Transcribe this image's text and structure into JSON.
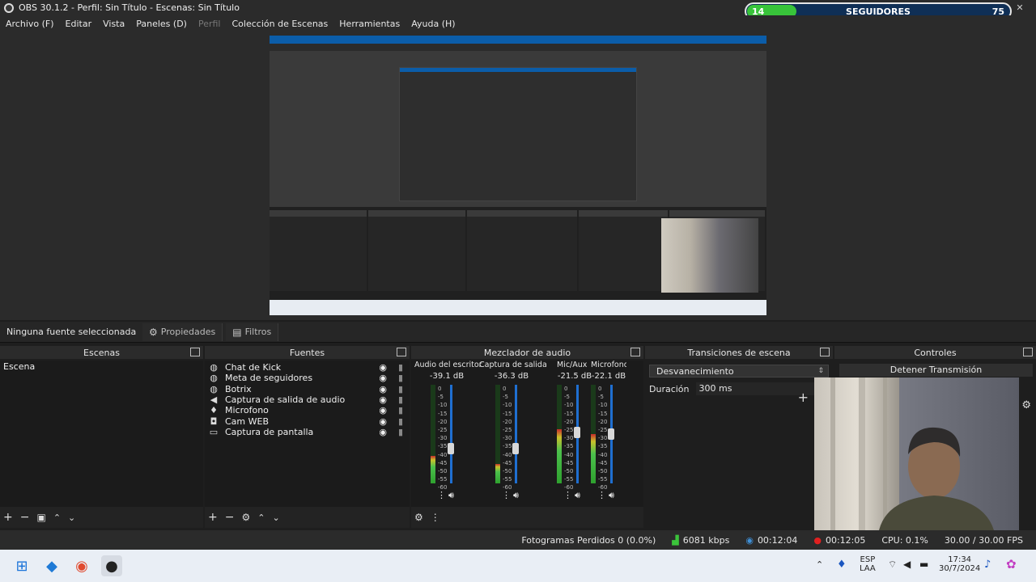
{
  "window": {
    "title": "OBS 30.1.2 - Perfil: Sin Título - Escenas: Sin Título"
  },
  "follower_widget": {
    "current": "14",
    "label": "SEGUIDORES",
    "goal": "75",
    "progress_fraction": 0.187
  },
  "menu": {
    "items": [
      "Archivo (F)",
      "Editar",
      "Vista",
      "Paneles (D)",
      "Perfil",
      "Colección de Escenas",
      "Herramientas",
      "Ayuda (H)"
    ]
  },
  "source_toolbar": {
    "no_selection": "Ninguna fuente seleccionada",
    "properties": "Propiedades",
    "filters": "Filtros"
  },
  "docks": {
    "scenes": {
      "title": "Escenas",
      "items": [
        "Escena"
      ]
    },
    "sources": {
      "title": "Fuentes",
      "items": [
        {
          "label": "Chat de Kick",
          "icon": "globe-icon"
        },
        {
          "label": "Meta de seguidores",
          "icon": "globe-icon"
        },
        {
          "label": "Botrix",
          "icon": "globe-icon"
        },
        {
          "label": "Captura de salida de audio",
          "icon": "speaker-icon"
        },
        {
          "label": "Microfono",
          "icon": "microphone-icon"
        },
        {
          "label": "Cam WEB",
          "icon": "camera-icon"
        },
        {
          "label": "Captura de pantalla",
          "icon": "monitor-icon"
        }
      ]
    },
    "mixer": {
      "title": "Mezclador de audio",
      "scale": [
        "0",
        "-5",
        "-10",
        "-15",
        "-20",
        "-25",
        "-30",
        "-35",
        "-40",
        "-45",
        "-50",
        "-55",
        "-60"
      ],
      "channels": [
        {
          "name": "Audio del escritorio",
          "db": "-39.1 dB",
          "level": 0.28,
          "volume": 0.35
        },
        {
          "name": "Captura de salida de au",
          "db": "-36.3 dB",
          "level": 0.2,
          "volume": 0.35
        },
        {
          "name": "Mic/Aux",
          "db": "-21.5 dB",
          "level": 0.55,
          "volume": 0.52
        },
        {
          "name": "Microfono",
          "db": "-22.1 dB",
          "level": 0.5,
          "volume": 0.5
        }
      ]
    },
    "transitions": {
      "title": "Transiciones de escena",
      "selected": "Desvanecimiento",
      "duration_label": "Duración",
      "duration_value": "300 ms"
    },
    "controls": {
      "title": "Controles",
      "stop_stream": "Detener Transmisión"
    }
  },
  "status_bar": {
    "dropped_frames": "Fotogramas Perdidos 0 (0.0%)",
    "bitrate": "6081 kbps",
    "rec_time": "00:12:04",
    "stream_time": "00:12:05",
    "cpu": "CPU: 0.1%",
    "fps": "30.00 / 30.00 FPS"
  },
  "taskbar": {
    "lang_top": "ESP",
    "lang_bottom": "LAA",
    "time": "17:34",
    "date": "30/7/2024"
  }
}
